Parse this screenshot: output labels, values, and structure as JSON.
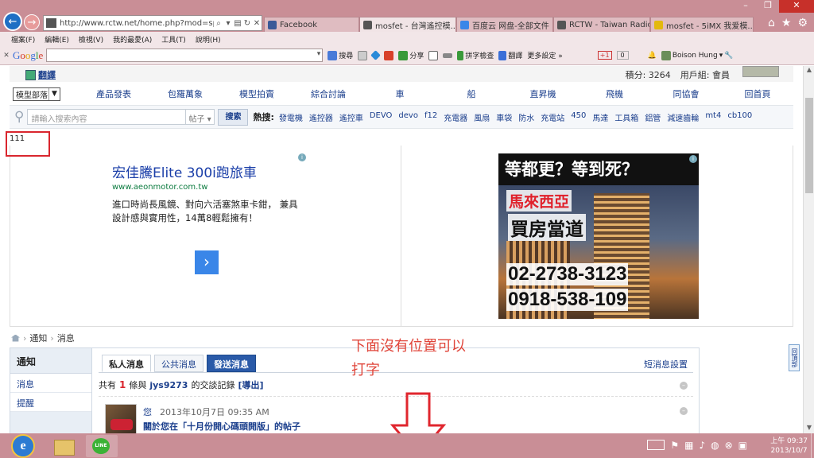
{
  "browser": {
    "address_url": "http://www.rctw.net/home.php?mod=space&d",
    "tabs": [
      {
        "label": "Facebook",
        "color": "#3b5998"
      },
      {
        "label": "mosfet - 台灣遙控模...",
        "color": "#555555",
        "active": true
      },
      {
        "label": "百度云 网盘-全部文件",
        "color": "#3a86e8"
      },
      {
        "label": "RCTW - Taiwan Radio ...",
        "color": "#555555"
      },
      {
        "label": "mosfet - 5iMX 我爱模...",
        "color": "#e3b90d"
      }
    ],
    "window_controls": {
      "minimize": "–",
      "maximize": "❐",
      "close": "✕"
    },
    "right_icons": {
      "home": "⌂",
      "favorites": "★",
      "settings": "⚙"
    },
    "menu": [
      "檔案(F)",
      "編輯(E)",
      "檢視(V)",
      "我的最愛(A)",
      "工具(T)",
      "說明(H)"
    ],
    "google_toolbar": {
      "logo": [
        "G",
        "o",
        "o",
        "g",
        "l",
        "e"
      ],
      "search_label": "搜尋",
      "share": "分享",
      "pinyin": "拼字檢查",
      "translate": "翻譯",
      "more": "更多設定 »",
      "plusone": "+1",
      "count": "0",
      "user": "Boison Hung"
    }
  },
  "forum": {
    "translate_link": "翻譯",
    "points_label": "積分: 3264",
    "group_label": "用戶組: 會員",
    "section_select": "模型部落",
    "nav_links": [
      "產品發表",
      "包羅萬象",
      "模型拍賣",
      "綜合討論",
      "車",
      "船",
      "直昇機",
      "飛機",
      "同協會",
      "回首頁"
    ],
    "search_placeholder": "請輸入搜索內容",
    "search_type": "帖子",
    "search_button": "搜索",
    "hot_label": "熱搜:",
    "hot_words": [
      "發電機",
      "遙控器",
      "遙控車",
      "DEVO",
      "devo",
      "f12",
      "充電器",
      "風扇",
      "車袋",
      "防水",
      "充電站",
      "450",
      "馬達",
      "工具箱",
      "鋁管",
      "減速齒輪",
      "mt4",
      "cb100"
    ],
    "note_text": "111"
  },
  "ads": {
    "left": {
      "title": "宏佳騰Elite 300i跑旅車",
      "url": "www.aeonmotor.com.tw",
      "desc": "進口時尚長風鏡、對向六活塞煞車卡鉗， 兼具設計感與實用性，14萬8輕鬆擁有！",
      "arrow": "›"
    },
    "right": {
      "headline": "等都更？等到死？",
      "region": "馬來西亞",
      "subhead": "買房當道",
      "phone1": "02-2738-3123",
      "phone2": "0918-538-109"
    },
    "choice_icon": "i"
  },
  "breadcrumb": [
    "通知",
    "消息"
  ],
  "sidebar": {
    "header": "通知",
    "items": [
      "消息",
      "提醒"
    ]
  },
  "messages": {
    "tabs": [
      "私人消息",
      "公共消息",
      "發送消息"
    ],
    "settings_link": "短消息設置",
    "records_prefix": "共有",
    "records_count": "1",
    "records_mid": "條與",
    "records_user": "jys9273",
    "records_suffix": "的交談記錄",
    "export": "[導出]",
    "item": {
      "author": "您",
      "time": "2013年10月7日 09:35 AM",
      "title": "關於您在「十月份開心碼頭開版」的帖子"
    }
  },
  "annotation": {
    "line1": "下面沒有位置可以",
    "line2": "打字"
  },
  "backtop": "回頂部",
  "taskbar": {
    "start": "e",
    "clock_time": "上午 09:37",
    "clock_date": "2013/10/7"
  }
}
